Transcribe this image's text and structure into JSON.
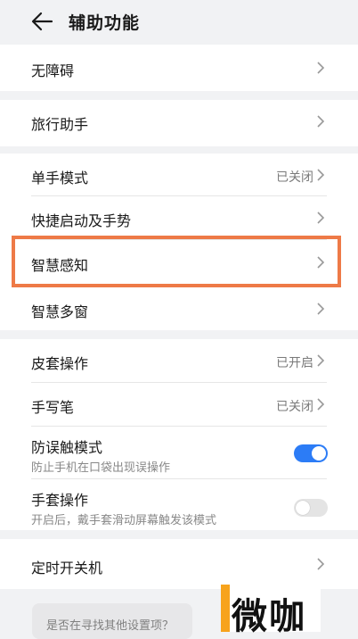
{
  "header": {
    "title": "辅助功能"
  },
  "groups": {
    "accessibility": {
      "label": "无障碍"
    },
    "travel": {
      "label": "旅行助手"
    },
    "main": {
      "one_hand": {
        "label": "单手模式",
        "value": "已关闭"
      },
      "shortcut": {
        "label": "快捷启动及手势"
      },
      "smart_sense": {
        "label": "智慧感知"
      },
      "multi_window": {
        "label": "智慧多窗"
      }
    },
    "accessories": {
      "cover": {
        "label": "皮套操作",
        "value": "已开启"
      },
      "stylus": {
        "label": "手写笔",
        "value": "已关闭"
      },
      "mistouch": {
        "label": "防误触模式",
        "desc": "防止手机在口袋出现误操作",
        "on": true
      },
      "glove": {
        "label": "手套操作",
        "desc": "开启后，戴手套滑动屏幕触发该模式",
        "on": false
      }
    },
    "timer": {
      "label": "定时开关机"
    }
  },
  "search_hint": "是否在寻找其他设置项？",
  "watermark_text": "微咖",
  "colors": {
    "accent": "#2c7cf6",
    "highlight": "#ee7a47",
    "background": "#f1f2f4",
    "watermark_bar": "#f7a31c"
  },
  "icons": {
    "back": "back-arrow-icon",
    "chevron": "chevron-right-icon"
  }
}
